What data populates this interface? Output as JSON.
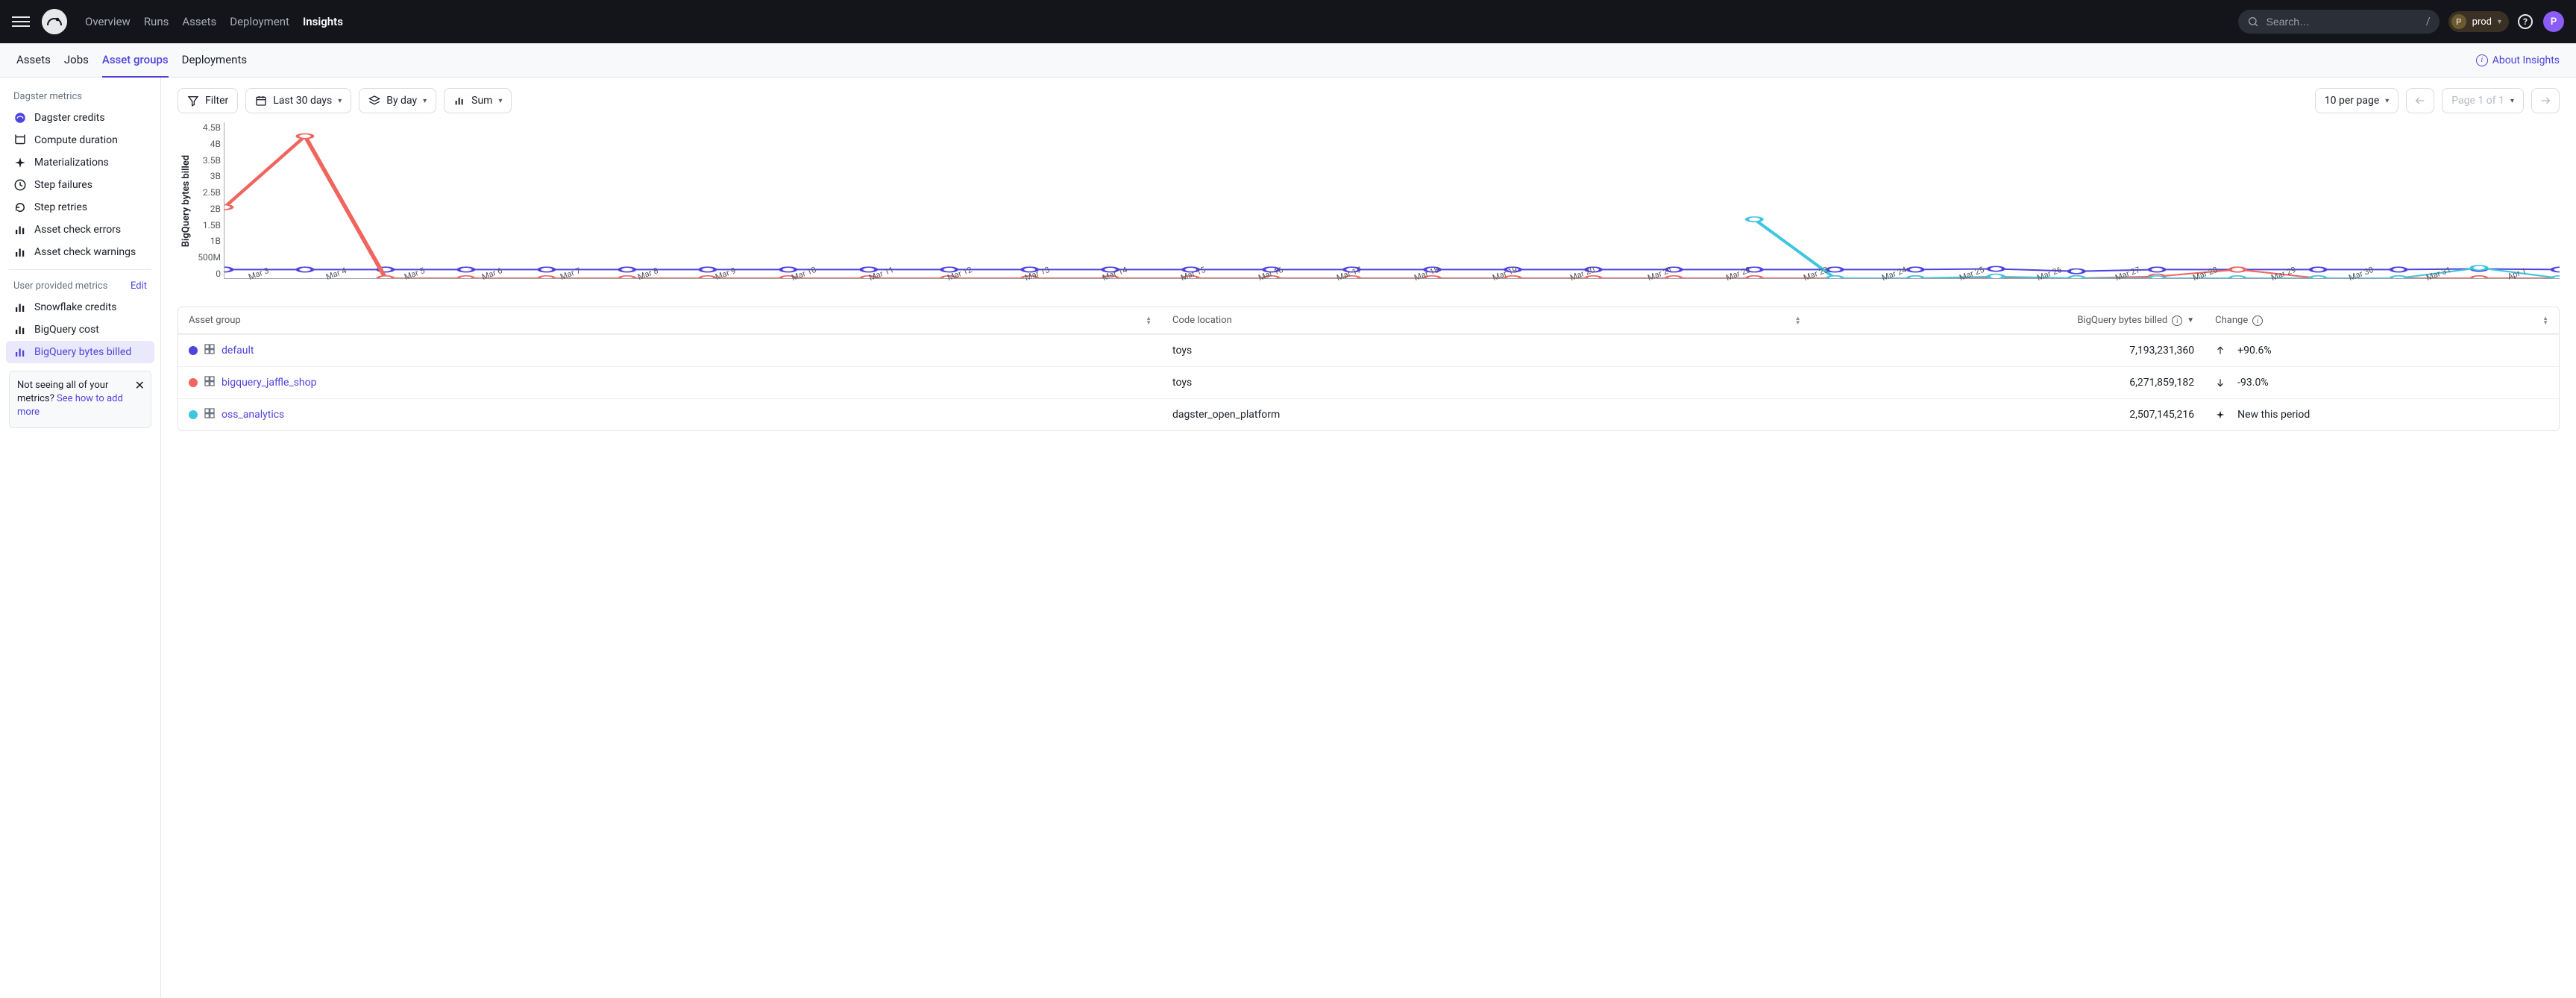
{
  "topnav": {
    "items": [
      "Overview",
      "Runs",
      "Assets",
      "Deployment",
      "Insights"
    ],
    "active": "Insights"
  },
  "search": {
    "placeholder": "Search…",
    "shortcut": "/"
  },
  "workspace": {
    "initial": "P",
    "label": "prod"
  },
  "avatar": {
    "initial": "P"
  },
  "subnav": {
    "tabs": [
      "Assets",
      "Jobs",
      "Asset groups",
      "Deployments"
    ],
    "active": "Asset groups",
    "about_link": "About Insights"
  },
  "sidebar": {
    "section1_title": "Dagster metrics",
    "section1_items": [
      {
        "icon": "credits",
        "label": "Dagster credits"
      },
      {
        "icon": "clock-down",
        "label": "Compute duration"
      },
      {
        "icon": "sparkle",
        "label": "Materializations"
      },
      {
        "icon": "clock",
        "label": "Step failures"
      },
      {
        "icon": "retry",
        "label": "Step retries"
      },
      {
        "icon": "bars",
        "label": "Asset check errors"
      },
      {
        "icon": "bars",
        "label": "Asset check warnings"
      }
    ],
    "section2_title": "User provided metrics",
    "section2_edit": "Edit",
    "section2_items": [
      {
        "icon": "bars",
        "label": "Snowflake credits"
      },
      {
        "icon": "bars",
        "label": "BigQuery cost"
      },
      {
        "icon": "bars",
        "label": "BigQuery bytes billed",
        "active": true
      }
    ],
    "notice": {
      "text_before": "Not seeing all of your metrics? ",
      "link_text": "See how to add more"
    }
  },
  "toolbar": {
    "filter": "Filter",
    "range": "Last 30 days",
    "granularity": "By day",
    "agg": "Sum",
    "per_page": "10 per page",
    "page_label": "Page 1 of 1"
  },
  "chart_data": {
    "type": "line",
    "ylabel": "BigQuery bytes billed",
    "yticks": [
      "4.5B",
      "4B",
      "3.5B",
      "3B",
      "2.5B",
      "2B",
      "1.5B",
      "1B",
      "500M",
      "0"
    ],
    "ylim": [
      0,
      4500000000
    ],
    "x": [
      "Mar 3",
      "Mar 4",
      "Mar 5",
      "Mar 6",
      "Mar 7",
      "Mar 8",
      "Mar 9",
      "Mar 10",
      "Mar 11",
      "Mar 12",
      "Mar 13",
      "Mar 14",
      "Mar 15",
      "Mar 16",
      "Mar 17",
      "Mar 18",
      "Mar 19",
      "Mar 20",
      "Mar 21",
      "Mar 22",
      "Mar 23",
      "Mar 24",
      "Mar 25",
      "Mar 26",
      "Mar 27",
      "Mar 28",
      "Mar 29",
      "Mar 30",
      "Mar 31",
      "Apr 1"
    ],
    "series": [
      {
        "name": "default",
        "color": "#4f43dd",
        "values": [
          250000000,
          250000000,
          250000000,
          250000000,
          250000000,
          250000000,
          250000000,
          250000000,
          250000000,
          250000000,
          250000000,
          250000000,
          250000000,
          250000000,
          250000000,
          250000000,
          250000000,
          250000000,
          250000000,
          250000000,
          250000000,
          250000000,
          270000000,
          200000000,
          250000000,
          250000000,
          250000000,
          250000000,
          270000000,
          250000000
        ]
      },
      {
        "name": "bigquery_jaffle_shop",
        "color": "#f0655d",
        "values": [
          2050000000,
          4100000000,
          0,
          0,
          0,
          0,
          0,
          0,
          0,
          0,
          0,
          0,
          0,
          0,
          0,
          0,
          0,
          0,
          0,
          0,
          0,
          0,
          0,
          0,
          50000000,
          250000000,
          0,
          0,
          0,
          0
        ]
      },
      {
        "name": "oss_analytics",
        "color": "#3ec6e0",
        "values": [
          null,
          null,
          null,
          null,
          null,
          null,
          null,
          null,
          null,
          null,
          null,
          null,
          null,
          null,
          null,
          null,
          null,
          null,
          null,
          1700000000,
          0,
          0,
          50000000,
          0,
          0,
          0,
          0,
          0,
          300000000,
          0
        ]
      }
    ]
  },
  "table": {
    "columns": {
      "col0": "Asset group",
      "col1": "Code location",
      "col2": "BigQuery bytes billed",
      "col3": "Change"
    },
    "rows": [
      {
        "color": "#4f43dd",
        "name": "default",
        "code_location": "toys",
        "value": "7,193,231,360",
        "change_dir": "up",
        "change": "+90.6%"
      },
      {
        "color": "#f0655d",
        "name": "bigquery_jaffle_shop",
        "code_location": "toys",
        "value": "6,271,859,182",
        "change_dir": "down",
        "change": "-93.0%"
      },
      {
        "color": "#3ec6e0",
        "name": "oss_analytics",
        "code_location": "dagster_open_platform",
        "value": "2,507,145,216",
        "change_dir": "new",
        "change": "New this period"
      }
    ]
  }
}
